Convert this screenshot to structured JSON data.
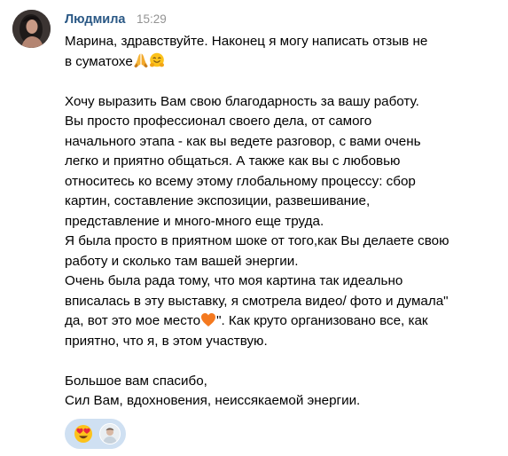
{
  "message": {
    "author": "Людмила",
    "time": "15:29",
    "lines": [
      "Марина, здравствуйте. Наконец я могу написать отзыв не",
      "в суматохе",
      "",
      "Хочу выразить Вам свою благодарность за вашу работу.",
      "Вы просто профессионал своего дела, от самого",
      "начального этапа - как вы ведете разговор, с вами очень",
      "легко и приятно общаться. А также как вы с любовью",
      "относитесь ко всему этому глобальному процессу: сбор",
      "картин, составление экспозиции, развешивание,",
      "представление и много-много еще труда.",
      "Я была просто в приятном шоке от того,как Вы делаете свою",
      "работу и сколько там вашей энергии.",
      "Очень была рада тому, что моя картина так идеально",
      "вписалась в эту выставку, я смотрела видео/ фото и думала\"",
      "да, вот это мое место",
      "\". Как круто организовано все, как",
      "приятно, что я, в этом участвую.",
      "",
      "Большое вам спасибо,",
      "Сил Вам, вдохновения, неиссякаемой энергии."
    ],
    "emojis": [
      "folded-hands-icon",
      "hugging-face-icon",
      "orange-heart-icon"
    ]
  },
  "reactions": {
    "emoji": "heart-eyes-icon",
    "count_shown": "1 avatar"
  },
  "colors": {
    "author": "#2a5885",
    "time": "#939393",
    "text": "#000000",
    "reaction_bg": "#cfe0f2"
  }
}
